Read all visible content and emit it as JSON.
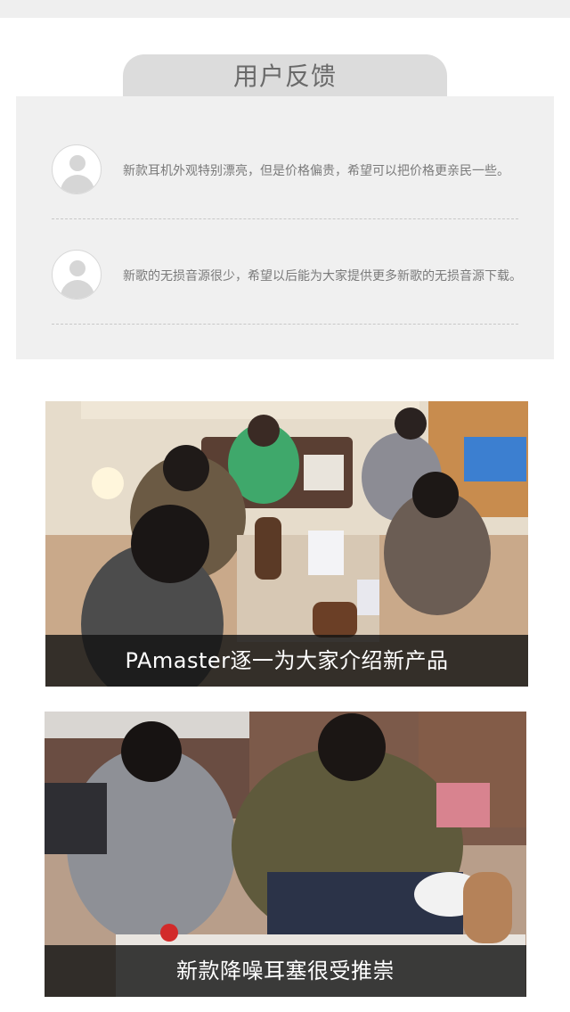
{
  "feedback": {
    "title": "用户反馈",
    "items": [
      {
        "text": "新款耳机外观特别漂亮，但是价格偏贵，希望可以把价格更亲民一些。"
      },
      {
        "text": "新歌的无损音源很少，希望以后能为大家提供更多新歌的无损音源下载。"
      }
    ]
  },
  "photos": [
    {
      "caption": "PAmaster逐一为大家介绍新产品"
    },
    {
      "caption": "新款降噪耳塞很受推崇"
    }
  ],
  "colors": {
    "title_bg": "#dcdcdc",
    "panel_bg": "#f0f0f0",
    "caption_bg": "#141414"
  }
}
